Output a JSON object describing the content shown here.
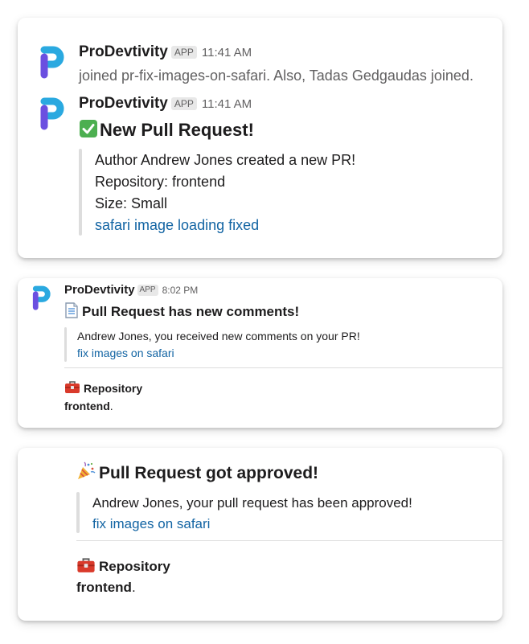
{
  "app": {
    "name": "ProDevtivity",
    "badge": "APP"
  },
  "card1": {
    "message1": {
      "time": "11:41 AM",
      "text": "joined pr-fix-images-on-safari. Also, Tadas Gedgaudas joined."
    },
    "message2": {
      "time": "11:41 AM",
      "title": "New Pull Request!",
      "lines": [
        "Author Andrew Jones created a new PR!",
        "Repository: frontend",
        "Size: Small"
      ],
      "link": "safari image loading fixed"
    }
  },
  "card2": {
    "time": "8:02 PM",
    "title": "Pull Request has new comments!",
    "quote": "Andrew Jones, you received new comments on your PR!",
    "link": "fix images on safari",
    "section_title": "Repository",
    "section_value": "frontend",
    "section_suffix": "."
  },
  "card3": {
    "title": "Pull Request got approved!",
    "quote": "Andrew Jones, your pull request has been approved!",
    "link": "fix images on safari",
    "section_title": "Repository",
    "section_value": "frontend",
    "section_suffix": "."
  },
  "colors": {
    "link": "#1264a3",
    "logo_blue": "#2aa9e0",
    "logo_purple": "#6b4fe0",
    "check_green": "#4caf50",
    "toolbox_red": "#d93a2b"
  },
  "icons": [
    "prodevtivity-logo-icon",
    "check-mark-icon",
    "page-facing-up-icon",
    "toolbox-icon",
    "party-popper-icon"
  ]
}
